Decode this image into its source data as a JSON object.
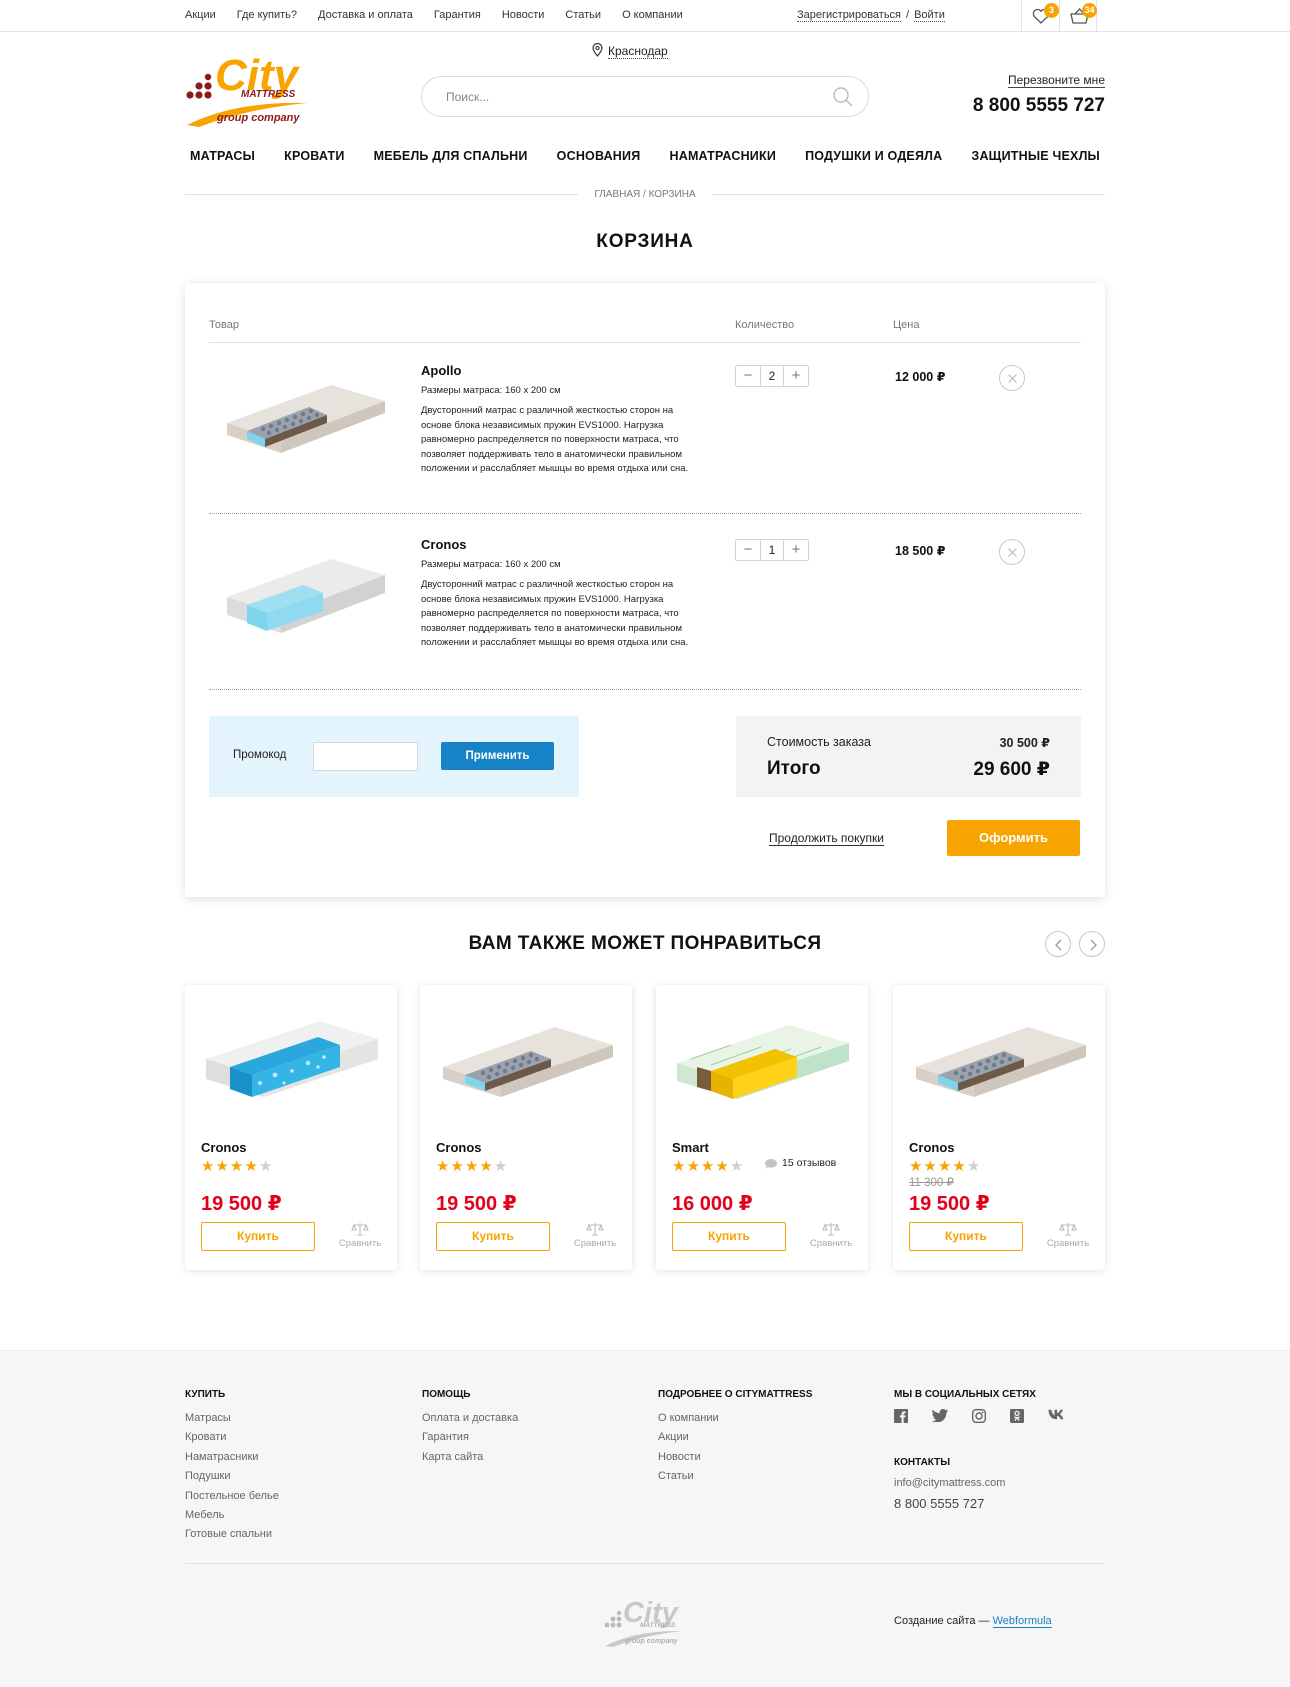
{
  "topbar": {
    "nav": [
      "Акции",
      "Где купить?",
      "Доставка и оплата",
      "Гарантия",
      "Новости",
      "Статьи",
      "О компании"
    ],
    "register": "Зарегистрироваться",
    "login": "Войти",
    "favorites_count": "3",
    "cart_count": "34"
  },
  "header": {
    "logo": {
      "city": "City",
      "mattress": "MATTRESS",
      "tagline": "group company"
    },
    "city": "Краснодар",
    "search_placeholder": "Поиск...",
    "callback": "Перезвоните мне",
    "phone": "8 800 5555 727"
  },
  "mainnav": [
    "МАТРАСЫ",
    "КРОВАТИ",
    "МЕБЕЛЬ ДЛЯ СПАЛЬНИ",
    "ОСНОВАНИЯ",
    "НАМАТРАСНИКИ",
    "ПОДУШКИ И ОДЕЯЛА",
    "ЗАЩИТНЫЕ ЧЕХЛЫ"
  ],
  "breadcrumb": "ГЛАВНАЯ  /  КОРЗИНА",
  "page_title": "КОРЗИНА",
  "cart": {
    "columns": {
      "product": "Товар",
      "quantity": "Количество",
      "price": "Цена"
    },
    "items": [
      {
        "name": "Apollo",
        "size": "Размеры матраса: 160 х 200 см",
        "description": "Двусторонний матрас с различной жесткостью сторон на основе блока независимых пружин EVS1000. Нагрузка равномерно распределяется по поверхности матраса, что позволяет поддерживать тело в анатомически правильном положении и расслабляет мышцы во время отдыха или сна.",
        "quantity": "2",
        "price": "12 000 ₽"
      },
      {
        "name": "Cronos",
        "size": "Размеры матраса: 160 х 200 см",
        "description": "Двусторонний матрас с различной жесткостью сторон на основе блока независимых пружин EVS1000. Нагрузка равномерно распределяется по поверхности матраса, что позволяет поддерживать тело в анатомически правильном положении и расслабляет мышцы во время отдыха или сна.",
        "quantity": "1",
        "price": "18 500 ₽"
      }
    ],
    "qty_minus": "−",
    "qty_plus": "+",
    "promo_label": "Промокод",
    "promo_value": "",
    "apply": "Применить",
    "order_cost_label": "Стоимость заказа",
    "order_cost": "30 500 ₽",
    "total_label": "Итого",
    "total": "29 600 ₽",
    "continue": "Продолжить покупки",
    "checkout": "Оформить"
  },
  "recommend": {
    "title": "ВАМ ТАКЖЕ МОЖЕТ ПОНРАВИТЬСЯ",
    "buy_label": "Купить",
    "compare_label": "Сравнить",
    "products": [
      {
        "name": "Cronos",
        "rating": 4,
        "reviews": "",
        "old_price": "",
        "price": "19 500 ₽"
      },
      {
        "name": "Cronos",
        "rating": 4,
        "reviews": "",
        "old_price": "",
        "price": "19 500 ₽"
      },
      {
        "name": "Smart",
        "rating": 4,
        "reviews": "15 отзывов",
        "old_price": "",
        "price": "16 000 ₽"
      },
      {
        "name": "Cronos",
        "rating": 4,
        "reviews": "",
        "old_price": "11 300 ₽",
        "price": "19 500 ₽"
      }
    ]
  },
  "footer": {
    "buy": {
      "title": "КУПИТЬ",
      "items": [
        "Матрасы",
        "Кровати",
        "Наматрасники",
        "Подушки",
        "Постельное белье",
        "Мебель",
        "Готовые спальни"
      ]
    },
    "help": {
      "title": "ПОМОЩЬ",
      "items": [
        "Оплата и доставка",
        "Гарантия",
        "Карта сайта"
      ]
    },
    "about": {
      "title": "ПОДРОБНЕЕ О CITYMATTRESS",
      "items": [
        "О компании",
        "Акции",
        "Новости",
        "Статьи"
      ]
    },
    "social_title": "МЫ В СОЦИАЛЬНЫХ СЕТЯХ",
    "social_icons": [
      "facebook-icon",
      "twitter-icon",
      "instagram-icon",
      "odnoklassniki-icon",
      "vk-icon"
    ],
    "contacts_title": "КОНТАКТЫ",
    "email": "info@citymattress.com",
    "phone": "8 800 5555 727",
    "credit": "Создание сайта — ",
    "credit_link": "Webformula"
  },
  "colors": {
    "accent": "#f7a300",
    "brand_blue": "#1683c6",
    "price_red": "#e3001b",
    "promo_bg": "#e3f4fd",
    "logo_red": "#8b1a1a"
  }
}
